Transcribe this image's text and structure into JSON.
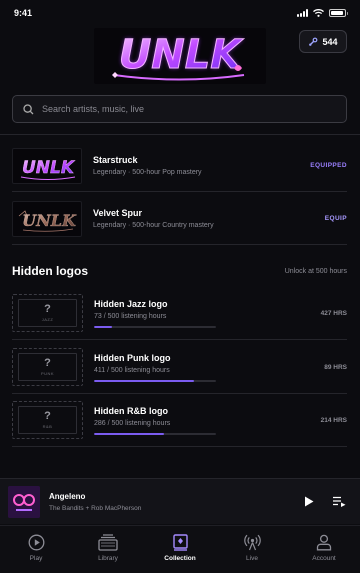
{
  "status_bar": {
    "time": "9:41"
  },
  "header": {
    "logo_text": "UNLK",
    "coins": "544"
  },
  "search": {
    "placeholder": "Search artists, music, live"
  },
  "equipped_logos": [
    {
      "title": "Starstruck",
      "subtitle": "Legendary · 500-hour Pop mastery",
      "action": "EQUIPPED",
      "action_color": "#9b80ff",
      "thumb_text": "UNLK"
    },
    {
      "title": "Velvet Spur",
      "subtitle": "Legendary · 500-hour Country mastery",
      "action": "EQUIP",
      "action_color": "#a899ff",
      "thumb_text": "UNLK"
    }
  ],
  "hidden_section": {
    "title": "Hidden logos",
    "hint": "Unlock at 500 hours"
  },
  "hidden_logos": [
    {
      "title": "Hidden Jazz logo",
      "subtitle": "73 / 500 listening hours",
      "genre": "JAZZ",
      "hours": "427 HRS",
      "progress": 0.146
    },
    {
      "title": "Hidden Punk logo",
      "subtitle": "411 / 500 listening hours",
      "genre": "PUNK",
      "hours": "89 HRS",
      "progress": 0.822
    },
    {
      "title": "Hidden R&B logo",
      "subtitle": "286 / 500 listening hours",
      "genre": "R&B",
      "hours": "214 HRS",
      "progress": 0.572
    }
  ],
  "mini_player": {
    "title": "Angeleno",
    "artist": "The Bandits + Rob MacPherson"
  },
  "tabs": [
    {
      "label": "Play",
      "icon": "play-circle-icon"
    },
    {
      "label": "Library",
      "icon": "library-icon"
    },
    {
      "label": "Collection",
      "icon": "collection-icon"
    },
    {
      "label": "Live",
      "icon": "broadcast-icon"
    },
    {
      "label": "Account",
      "icon": "person-icon"
    }
  ],
  "colors": {
    "accent": "#7b5cf0",
    "background": "#0c0c10"
  }
}
